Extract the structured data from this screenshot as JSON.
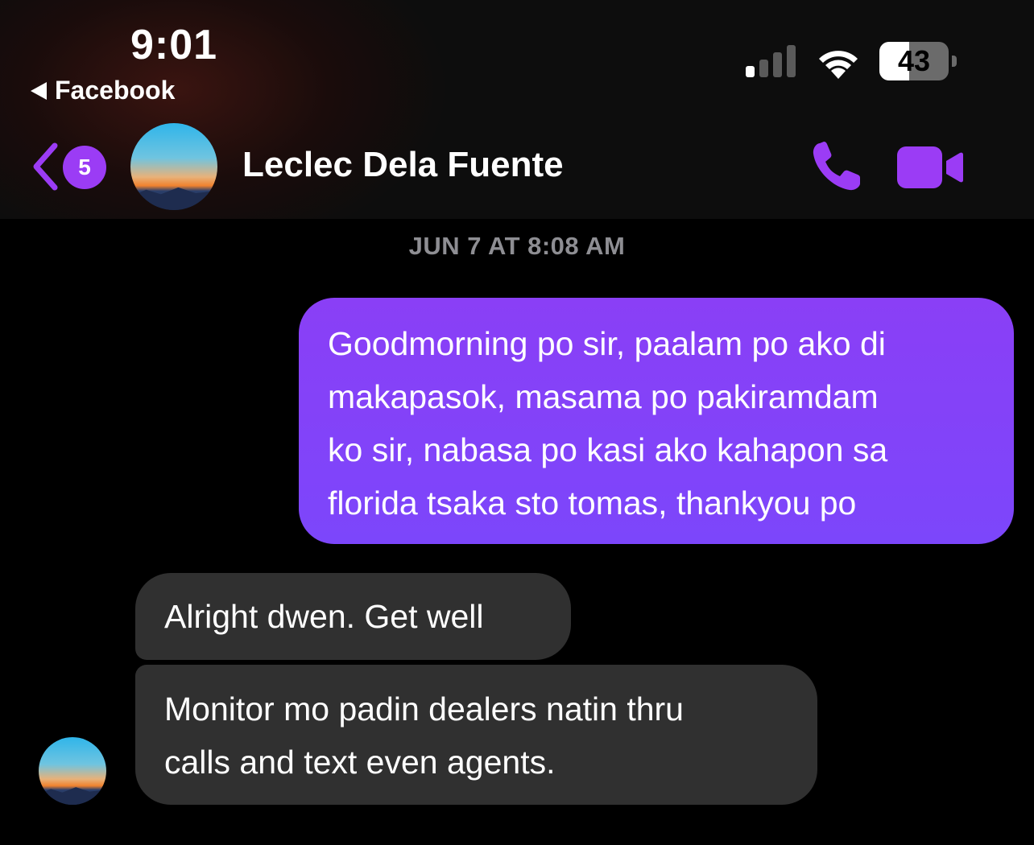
{
  "status_bar": {
    "time": "9:01",
    "back_app_label": "Facebook",
    "battery_level": "43",
    "battery_fraction": 0.43,
    "signal_bars_active": 1,
    "signal_bars_total": 4
  },
  "header": {
    "unread_count": "5",
    "contact_name": "Leclec Dela Fuente",
    "accent_color": "#9b3cf5"
  },
  "conversation": {
    "timestamp": "JUN 7 AT 8:08 AM",
    "messages": [
      {
        "direction": "outgoing",
        "text": "Goodmorning po sir, paalam po ako di\nmakapasok, masama po pakiramdam\nko sir, nabasa po kasi ako kahapon sa\nflorida tsaka sto tomas, thankyou po"
      },
      {
        "direction": "incoming",
        "text": "Alright dwen. Get well"
      },
      {
        "direction": "incoming",
        "text": "Monitor mo padin dealers natin thru\ncalls and text even agents."
      }
    ]
  },
  "colors": {
    "outgoing_bubble": "#8a3ff6",
    "incoming_bubble": "#303030",
    "background": "#000000",
    "timestamp_text": "#8e8e93"
  }
}
